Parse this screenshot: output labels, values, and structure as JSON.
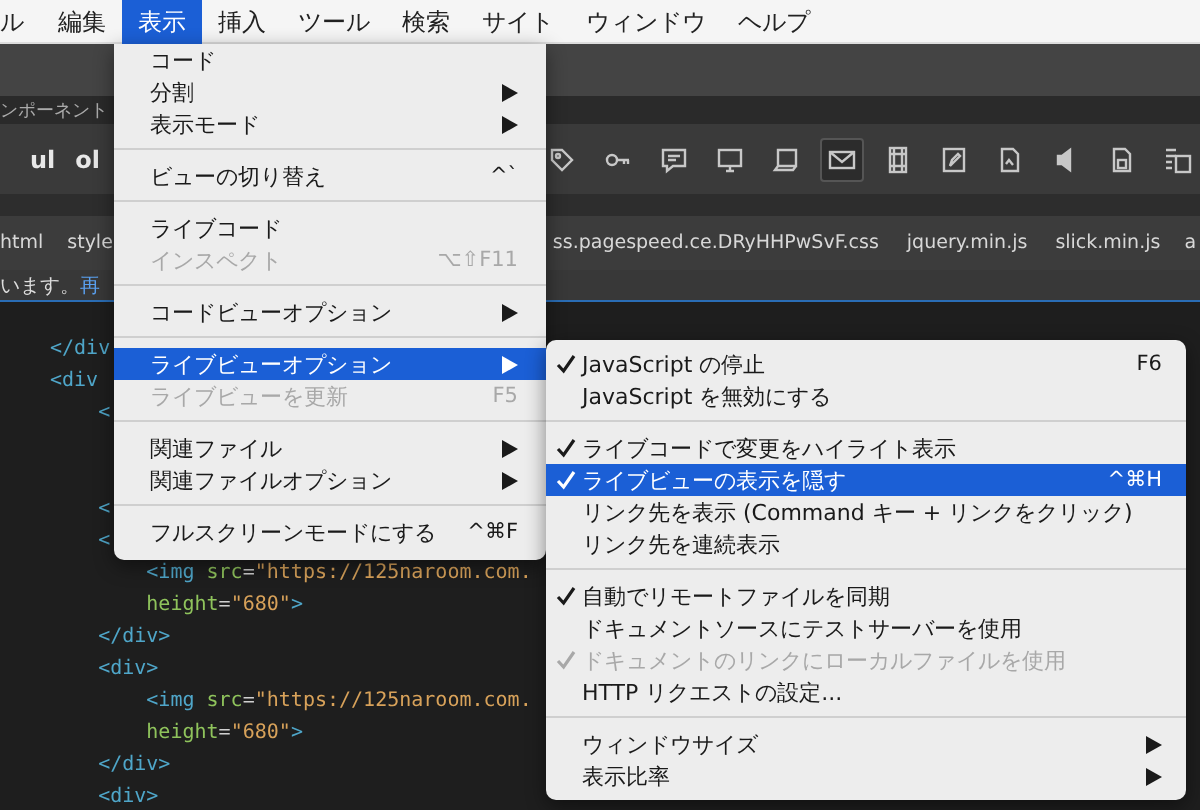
{
  "menubar": [
    {
      "label": "ル",
      "selected": false
    },
    {
      "label": "編集",
      "selected": false
    },
    {
      "label": "表示",
      "selected": true
    },
    {
      "label": "挿入",
      "selected": false
    },
    {
      "label": "ツール",
      "selected": false
    },
    {
      "label": "検索",
      "selected": false
    },
    {
      "label": "サイト",
      "selected": false
    },
    {
      "label": "ウィンドウ",
      "selected": false
    },
    {
      "label": "ヘルプ",
      "selected": false
    }
  ],
  "panel_tab": "ンポーネント",
  "toolbar": {
    "buttons": [
      "ul",
      "ol"
    ],
    "icons": [
      {
        "selected": false
      },
      {
        "selected": false
      },
      {
        "selected": false
      },
      {
        "selected": false
      },
      {
        "selected": false
      },
      {
        "selected": true
      },
      {
        "selected": false
      },
      {
        "selected": false
      },
      {
        "selected": false
      },
      {
        "selected": false
      },
      {
        "selected": false
      },
      {
        "selected": false
      }
    ]
  },
  "file_tabs": [
    {
      "label": "html"
    },
    {
      "label": "style"
    },
    {
      "label": "ss.pagespeed.ce.DRyHHPwSvF.css"
    },
    {
      "label": "jquery.min.js"
    },
    {
      "label": "slick.min.js"
    },
    {
      "label": "a"
    }
  ],
  "info_bar": {
    "text": "います。",
    "link": "再"
  },
  "code_lines": [
    {
      "tokens": [
        {
          "kind": "tag",
          "text": "</div"
        }
      ]
    },
    {
      "tokens": [
        {
          "kind": "tag",
          "text": "<div"
        }
      ]
    },
    {
      "tokens": [
        {
          "kind": "tag",
          "text": "    <"
        }
      ]
    },
    {
      "tokens": [
        {
          "kind": "tag",
          "text": "    <"
        }
      ]
    },
    {
      "tokens": [
        {
          "kind": "tag",
          "text": "    <"
        }
      ]
    },
    {
      "tokens": [
        {
          "kind": "tag",
          "text": "        <img"
        },
        {
          "kind": "attr",
          "text": " src"
        },
        {
          "kind": "punct",
          "text": "="
        },
        {
          "kind": "string",
          "text": "\"https://125naroom.com."
        }
      ]
    },
    {
      "tokens": [
        {
          "kind": "attr",
          "text": "        height"
        },
        {
          "kind": "punct",
          "text": "="
        },
        {
          "kind": "string",
          "text": "\"680\""
        },
        {
          "kind": "tag",
          "text": ">"
        }
      ]
    },
    {
      "tokens": [
        {
          "kind": "tag",
          "text": "    </div>"
        }
      ]
    },
    {
      "tokens": [
        {
          "kind": "tag",
          "text": "    <div>"
        }
      ]
    },
    {
      "tokens": [
        {
          "kind": "tag",
          "text": "        <img"
        },
        {
          "kind": "attr",
          "text": " src"
        },
        {
          "kind": "punct",
          "text": "="
        },
        {
          "kind": "string",
          "text": "\"https://125naroom.com."
        }
      ]
    },
    {
      "tokens": [
        {
          "kind": "attr",
          "text": "        height"
        },
        {
          "kind": "punct",
          "text": "="
        },
        {
          "kind": "string",
          "text": "\"680\""
        },
        {
          "kind": "tag",
          "text": ">"
        }
      ]
    },
    {
      "tokens": [
        {
          "kind": "tag",
          "text": "    </div>"
        }
      ]
    },
    {
      "tokens": [
        {
          "kind": "tag",
          "text": "    <div>"
        }
      ]
    }
  ],
  "view_menu": {
    "groups": [
      [
        {
          "label": "コード",
          "submenu": false,
          "disabled": false,
          "selected": false
        },
        {
          "label": "分割",
          "submenu": true,
          "disabled": false,
          "selected": false
        },
        {
          "label": "表示モード",
          "submenu": true,
          "disabled": false,
          "selected": false
        }
      ],
      [
        {
          "label": "ビューの切り替え",
          "shortcut": "^`",
          "submenu": false,
          "disabled": false,
          "selected": false
        }
      ],
      [
        {
          "label": "ライブコード",
          "submenu": false,
          "disabled": false,
          "selected": false
        },
        {
          "label": "インスペクト",
          "shortcut": "⌥⇧F11",
          "submenu": false,
          "disabled": true,
          "selected": false
        }
      ],
      [
        {
          "label": "コードビューオプション",
          "submenu": true,
          "disabled": false,
          "selected": false
        }
      ],
      [
        {
          "label": "ライブビューオプション",
          "submenu": true,
          "disabled": false,
          "selected": true
        },
        {
          "label": "ライブビューを更新",
          "shortcut": "F5",
          "submenu": false,
          "disabled": true,
          "selected": false
        }
      ],
      [
        {
          "label": "関連ファイル",
          "submenu": true,
          "disabled": false,
          "selected": false
        },
        {
          "label": "関連ファイルオプション",
          "submenu": true,
          "disabled": false,
          "selected": false
        }
      ],
      [
        {
          "label": "フルスクリーンモードにする",
          "shortcut": "^⌘F",
          "submenu": false,
          "disabled": false,
          "selected": false
        }
      ]
    ]
  },
  "live_view_submenu": {
    "groups": [
      [
        {
          "label": "JavaScript の停止",
          "shortcut": "F6",
          "checked": true,
          "submenu": false,
          "disabled": false,
          "selected": false
        },
        {
          "label": "JavaScript を無効にする",
          "checked": false,
          "submenu": false,
          "disabled": false,
          "selected": false
        }
      ],
      [
        {
          "label": "ライブコードで変更をハイライト表示",
          "checked": true,
          "submenu": false,
          "disabled": false,
          "selected": false
        },
        {
          "label": "ライブビューの表示を隠す",
          "shortcut": "^⌘H",
          "checked": true,
          "submenu": false,
          "disabled": false,
          "selected": true
        },
        {
          "label": "リンク先を表示 (Command キー + リンクをクリック)",
          "checked": false,
          "submenu": false,
          "disabled": false,
          "selected": false
        },
        {
          "label": "リンク先を連続表示",
          "checked": false,
          "submenu": false,
          "disabled": false,
          "selected": false
        }
      ],
      [
        {
          "label": "自動でリモートファイルを同期",
          "checked": true,
          "submenu": false,
          "disabled": false,
          "selected": false
        },
        {
          "label": "ドキュメントソースにテストサーバーを使用",
          "checked": false,
          "submenu": false,
          "disabled": false,
          "selected": false
        },
        {
          "label": "ドキュメントのリンクにローカルファイルを使用",
          "checked": true,
          "submenu": false,
          "disabled": true,
          "selected": false
        },
        {
          "label": "HTTP リクエストの設定...",
          "checked": false,
          "submenu": false,
          "disabled": false,
          "selected": false
        }
      ],
      [
        {
          "label": "ウィンドウサイズ",
          "checked": false,
          "submenu": true,
          "disabled": false,
          "selected": false
        },
        {
          "label": "表示比率",
          "checked": false,
          "submenu": true,
          "disabled": false,
          "selected": false
        }
      ]
    ]
  }
}
